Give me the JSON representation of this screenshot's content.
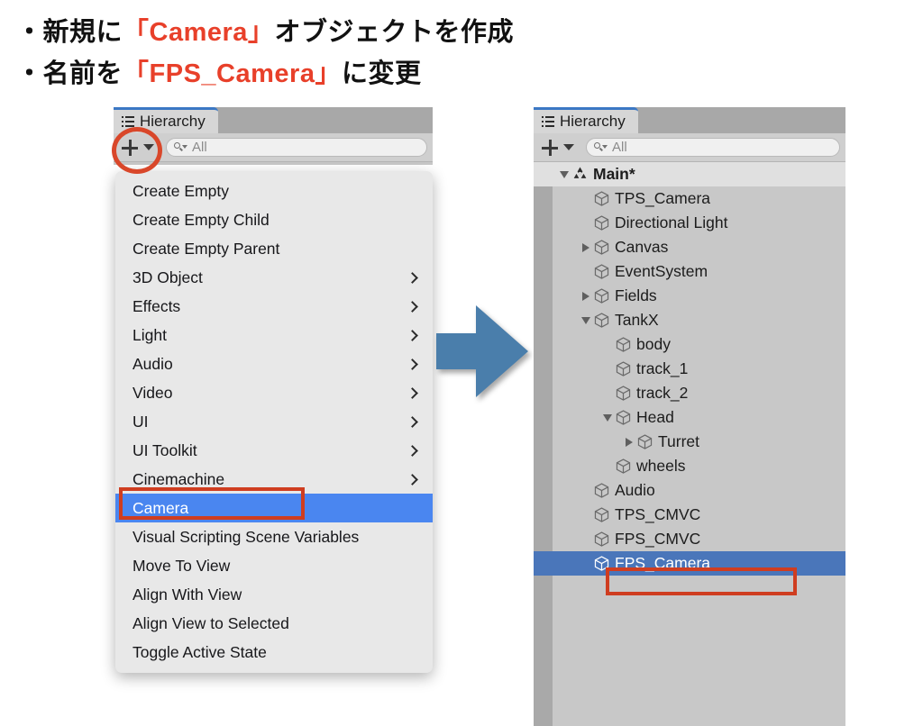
{
  "slide": {
    "bullets": [
      {
        "bullet": "・",
        "pre": "新規に",
        "highlight": "「Camera」",
        "post": "オブジェクトを作成"
      },
      {
        "bullet": "・",
        "pre": "名前を",
        "highlight": "「FPS_Camera」",
        "post": "に変更"
      }
    ],
    "accent_color": "#e8402a"
  },
  "left_panel": {
    "tab_label": "Hierarchy",
    "tab_icon": "hierarchy-list-icon",
    "toolbar": {
      "add_button_icon": "plus-icon",
      "add_button_caret_icon": "caret-down-icon",
      "search_icon": "search-dropdown-icon",
      "search_placeholder": "All",
      "search_value": ""
    },
    "menu": {
      "items": [
        {
          "label": "Create Empty",
          "submenu": false,
          "selected": false
        },
        {
          "label": "Create Empty Child",
          "submenu": false,
          "selected": false
        },
        {
          "label": "Create Empty Parent",
          "submenu": false,
          "selected": false
        },
        {
          "label": "3D Object",
          "submenu": true,
          "selected": false
        },
        {
          "label": "Effects",
          "submenu": true,
          "selected": false
        },
        {
          "label": "Light",
          "submenu": true,
          "selected": false
        },
        {
          "label": "Audio",
          "submenu": true,
          "selected": false
        },
        {
          "label": "Video",
          "submenu": true,
          "selected": false
        },
        {
          "label": "UI",
          "submenu": true,
          "selected": false
        },
        {
          "label": "UI Toolkit",
          "submenu": true,
          "selected": false
        },
        {
          "label": "Cinemachine",
          "submenu": true,
          "selected": false
        },
        {
          "label": "Camera",
          "submenu": false,
          "selected": true
        },
        {
          "label": "Visual Scripting Scene Variables",
          "submenu": false,
          "selected": false
        },
        {
          "label": "Move To View",
          "submenu": false,
          "selected": false
        },
        {
          "label": "Align With View",
          "submenu": false,
          "selected": false
        },
        {
          "label": "Align View to Selected",
          "submenu": false,
          "selected": false
        },
        {
          "label": "Toggle Active State",
          "submenu": false,
          "selected": false
        }
      ],
      "highlight_color": "#4a86f0"
    },
    "annotation": {
      "circle_target": "add-dropdown-button",
      "rect_target": "menu-item-camera",
      "color": "#d9472a"
    }
  },
  "arrow": {
    "direction": "right",
    "color": "#4a7eab"
  },
  "right_panel": {
    "tab_label": "Hierarchy",
    "tab_icon": "hierarchy-list-icon",
    "toolbar": {
      "add_button_icon": "plus-icon",
      "add_button_caret_icon": "caret-down-icon",
      "search_icon": "search-dropdown-icon",
      "search_placeholder": "All",
      "search_value": ""
    },
    "tree": {
      "rows": [
        {
          "label": "Main*",
          "depth": 0,
          "twisty": "down",
          "icon": "unity-scene-icon",
          "root": true,
          "selected": false
        },
        {
          "label": "TPS_Camera",
          "depth": 1,
          "twisty": "none",
          "icon": "gameobject-cube-icon",
          "root": false,
          "selected": false
        },
        {
          "label": "Directional Light",
          "depth": 1,
          "twisty": "none",
          "icon": "gameobject-cube-icon",
          "root": false,
          "selected": false
        },
        {
          "label": "Canvas",
          "depth": 1,
          "twisty": "right",
          "icon": "gameobject-cube-icon",
          "root": false,
          "selected": false
        },
        {
          "label": "EventSystem",
          "depth": 1,
          "twisty": "none",
          "icon": "gameobject-cube-icon",
          "root": false,
          "selected": false
        },
        {
          "label": "Fields",
          "depth": 1,
          "twisty": "right",
          "icon": "gameobject-cube-icon",
          "root": false,
          "selected": false
        },
        {
          "label": "TankX",
          "depth": 1,
          "twisty": "down",
          "icon": "gameobject-cube-icon",
          "root": false,
          "selected": false
        },
        {
          "label": "body",
          "depth": 2,
          "twisty": "none",
          "icon": "gameobject-cube-icon",
          "root": false,
          "selected": false
        },
        {
          "label": "track_1",
          "depth": 2,
          "twisty": "none",
          "icon": "gameobject-cube-icon",
          "root": false,
          "selected": false
        },
        {
          "label": "track_2",
          "depth": 2,
          "twisty": "none",
          "icon": "gameobject-cube-icon",
          "root": false,
          "selected": false
        },
        {
          "label": "Head",
          "depth": 2,
          "twisty": "down",
          "icon": "gameobject-cube-icon",
          "root": false,
          "selected": false
        },
        {
          "label": "Turret",
          "depth": 3,
          "twisty": "right",
          "icon": "gameobject-cube-icon",
          "root": false,
          "selected": false
        },
        {
          "label": "wheels",
          "depth": 2,
          "twisty": "none",
          "icon": "gameobject-cube-icon",
          "root": false,
          "selected": false
        },
        {
          "label": "Audio",
          "depth": 1,
          "twisty": "none",
          "icon": "gameobject-cube-icon",
          "root": false,
          "selected": false
        },
        {
          "label": "TPS_CMVC",
          "depth": 1,
          "twisty": "none",
          "icon": "gameobject-cube-icon",
          "root": false,
          "selected": false
        },
        {
          "label": "FPS_CMVC",
          "depth": 1,
          "twisty": "none",
          "icon": "gameobject-cube-icon",
          "root": false,
          "selected": false
        },
        {
          "label": "FPS_Camera",
          "depth": 1,
          "twisty": "none",
          "icon": "gameobject-cube-icon",
          "root": false,
          "selected": true
        }
      ],
      "selection_color": "#4a76ba"
    },
    "annotation": {
      "rect_target": "tree-row-fps-camera",
      "color": "#cf3d20"
    }
  }
}
